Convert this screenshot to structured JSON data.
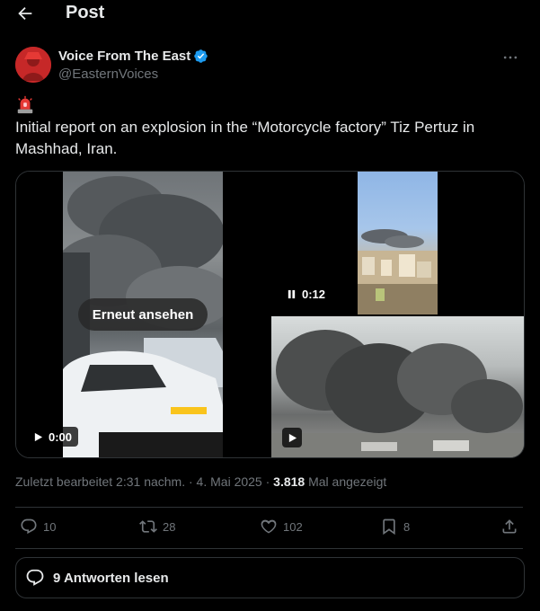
{
  "header": {
    "title": "Post",
    "back_icon": "arrow-left-icon"
  },
  "author": {
    "display_name": "Voice From The East",
    "handle": "@EasternVoices",
    "verified": true
  },
  "post": {
    "emoji": "police-light",
    "text": "Initial report on an explosion in the “Motorcycle factory” Tiz Pertuz in Mashhad, Iran."
  },
  "media": {
    "video1": {
      "replay_label": "Erneut ansehen",
      "time": "0:00"
    },
    "video2": {
      "time": "0:12"
    }
  },
  "meta": {
    "edited": "Zuletzt bearbeitet 2:31 nachm. · 4. Mai 2025 ·",
    "views_count": "3.818",
    "views_label": "Mal angezeigt"
  },
  "actions": {
    "replies": "10",
    "reposts": "28",
    "likes": "102",
    "bookmarks": "8"
  },
  "replies_button": {
    "label": "9 Antworten lesen"
  },
  "colors": {
    "background": "#000000",
    "text": "#e7e9ea",
    "muted": "#71767b",
    "verified": "#1d9bf0",
    "border": "#2f3336"
  }
}
